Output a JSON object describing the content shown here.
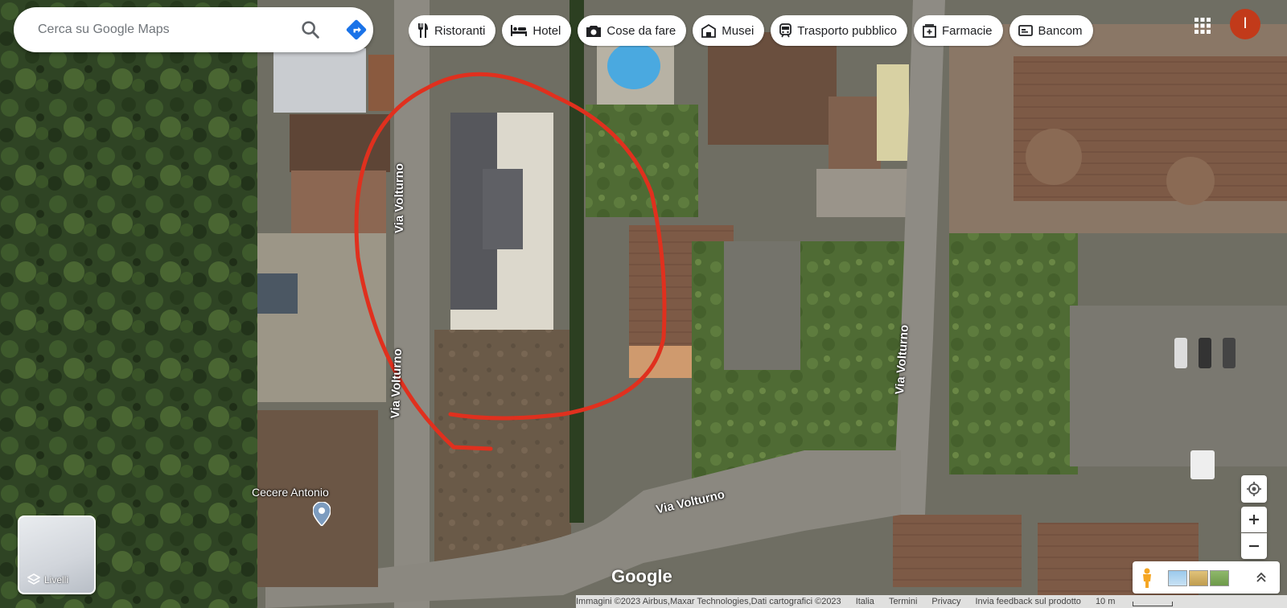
{
  "search": {
    "placeholder": "Cerca su Google Maps"
  },
  "categories": [
    {
      "label": "Ristoranti",
      "icon": "fork-knife-icon"
    },
    {
      "label": "Hotel",
      "icon": "bed-icon"
    },
    {
      "label": "Cose da fare",
      "icon": "camera-icon"
    },
    {
      "label": "Musei",
      "icon": "museum-icon"
    },
    {
      "label": "Trasporto pubblico",
      "icon": "train-icon"
    },
    {
      "label": "Farmacie",
      "icon": "pharmacy-icon"
    },
    {
      "label": "Bancom",
      "icon": "atm-card-icon"
    }
  ],
  "account": {
    "initial": "I",
    "color": "#c23a1a"
  },
  "layers": {
    "label": "Livelli"
  },
  "streets": {
    "north_west": "Via Volturno",
    "mid_west": "Via Volturno",
    "east": "Via Volturno",
    "south": "Via Volturno"
  },
  "place": {
    "label": "Cecere Antonio"
  },
  "logo": "Google",
  "footer": {
    "imagery": "Immagini ©2023 Airbus,Maxar Technologies,Dati cartografici ©2023",
    "country": "Italia",
    "terms": "Termini",
    "privacy": "Privacy",
    "feedback": "Invia feedback sul prodotto",
    "scale": "10 m"
  },
  "colors": {
    "annotation": "#e0301e",
    "accent": "#1a73e8"
  }
}
